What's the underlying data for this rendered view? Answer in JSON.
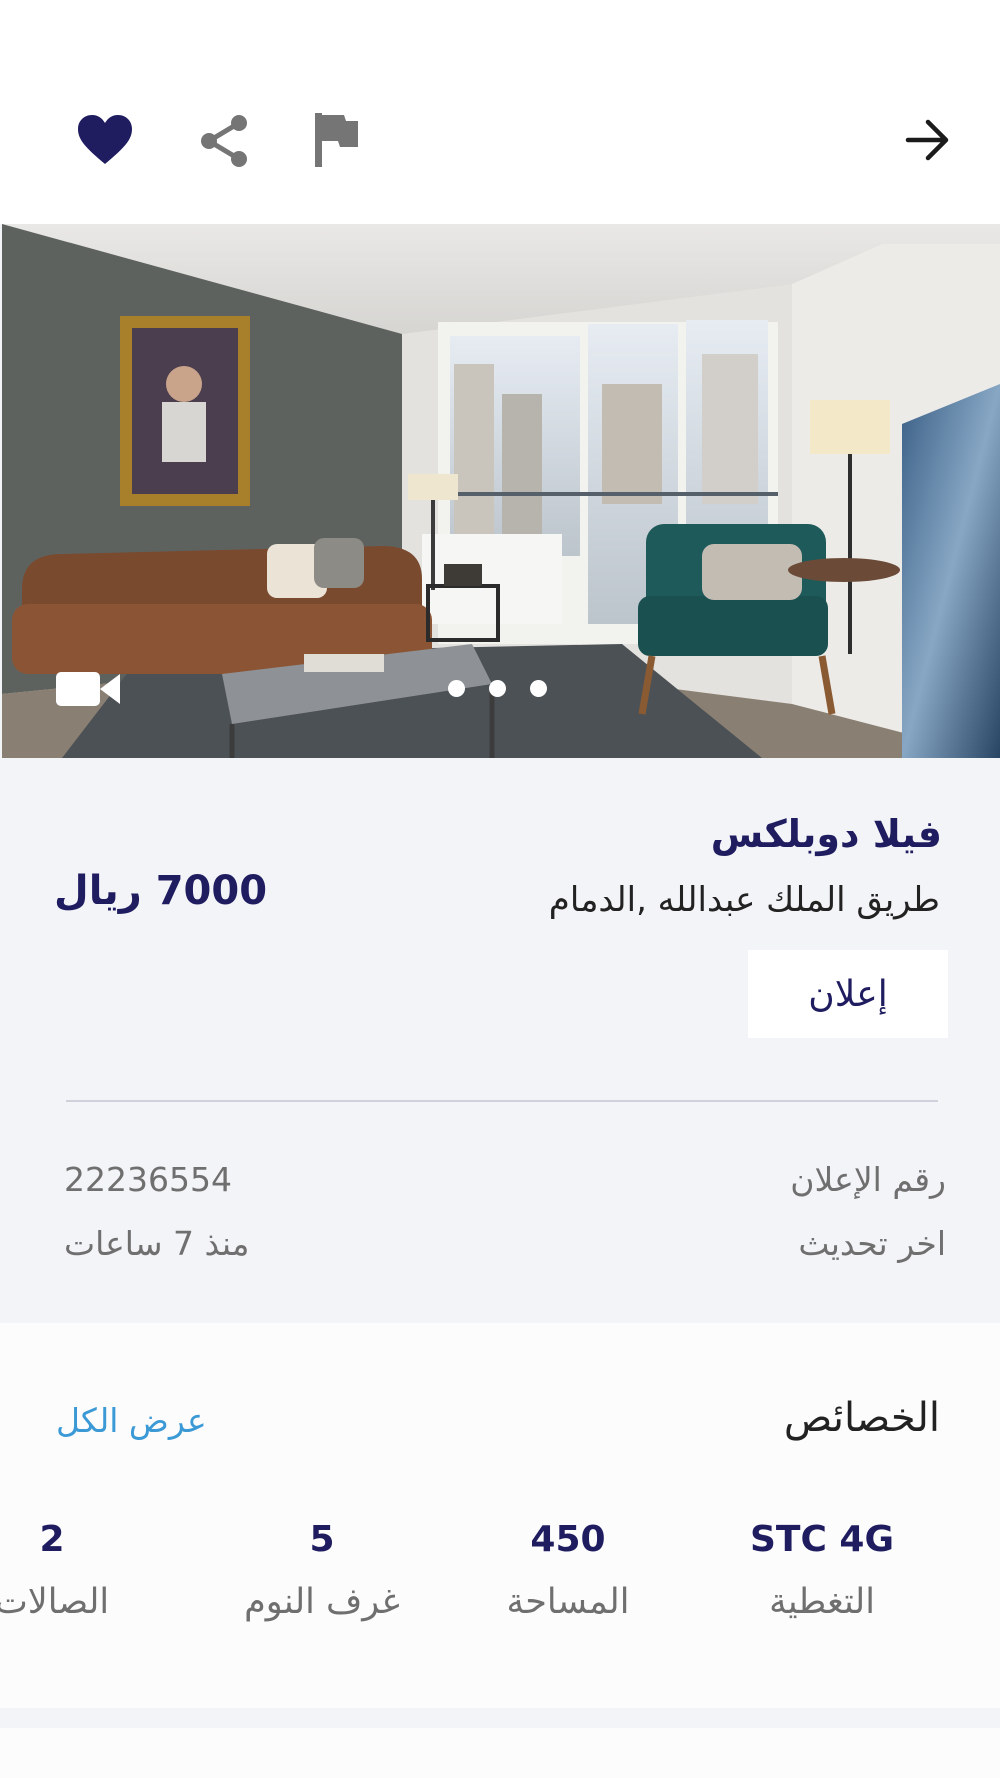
{
  "toolbar": {
    "back_icon": "arrow-right-icon",
    "flag_icon": "flag-icon",
    "share_icon": "share-icon",
    "favorite_icon": "heart-icon",
    "favorite_color": "#1f1c60",
    "icon_gray": "#757575"
  },
  "gallery": {
    "video_icon": "video-camera-icon",
    "dot_count": 3
  },
  "listing": {
    "title": "فيلا دوبلكس",
    "address": "طريق الملك عبدالله ,الدمام",
    "price": "7000 ريال",
    "badge": "إعلان",
    "ad_number_label": "رقم الإعلان",
    "ad_number_value": "22236554",
    "last_update_label": "اخر تحديث",
    "last_update_value": "منذ 7 ساعات"
  },
  "features": {
    "title": "الخصائص",
    "view_all": "عرض الكل",
    "items": [
      {
        "value": "STC 4G",
        "label": "التغطية"
      },
      {
        "value": "450",
        "label": "المساحة"
      },
      {
        "value": "5",
        "label": "غرف النوم"
      },
      {
        "value": "2",
        "label": "الصالات"
      }
    ]
  },
  "colors": {
    "primary": "#1f1c60",
    "link": "#3b9ad6",
    "background": "#f3f4f8"
  }
}
